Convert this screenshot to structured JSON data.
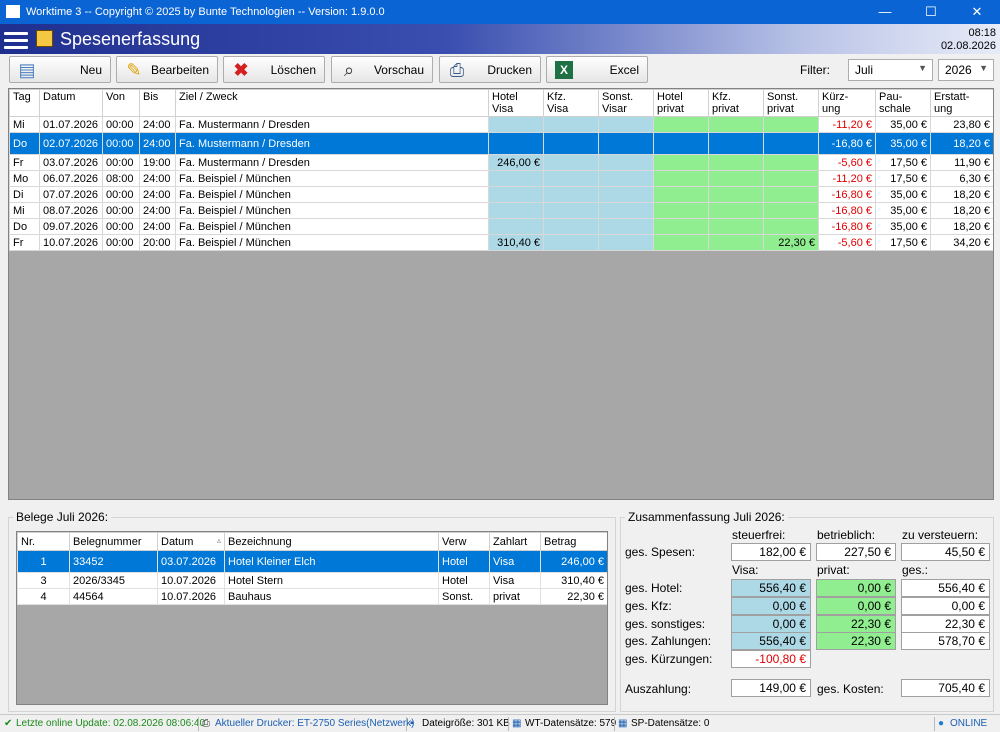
{
  "window": {
    "title": "Worktime 3 -- Copyright © 2025 by Bunte Technologien -- Version: 1.9.0.0",
    "minimize": "—",
    "maximize": "☐",
    "close": "✕"
  },
  "app": {
    "title": "Spesenerfassung",
    "time": "08:18",
    "date": "02.08.2026"
  },
  "toolbar": {
    "new": "Neu",
    "edit": "Bearbeiten",
    "delete": "Löschen",
    "preview": "Vorschau",
    "print": "Drucken",
    "excel": "Excel",
    "filter_label": "Filter:",
    "month": "Juli",
    "year": "2026"
  },
  "grid": {
    "headers": [
      [
        "Tag",
        ""
      ],
      [
        "Datum",
        ""
      ],
      [
        "Von",
        ""
      ],
      [
        "Bis",
        ""
      ],
      [
        "Ziel / Zweck",
        ""
      ],
      [
        "Hotel",
        "Visa"
      ],
      [
        "Kfz.",
        "Visa"
      ],
      [
        "Sonst.",
        "Visar"
      ],
      [
        "Hotel",
        "privat"
      ],
      [
        "Kfz.",
        "privat"
      ],
      [
        "Sonst.",
        "privat"
      ],
      [
        "Kürz-",
        "ung"
      ],
      [
        "Pau-",
        "schale"
      ],
      [
        "Erstatt-",
        "ung"
      ]
    ],
    "rows": [
      {
        "tag": "Mi",
        "datum": "01.07.2026",
        "von": "00:00",
        "bis": "24:00",
        "ziel": "Fa. Mustermann / Dresden",
        "hv": "",
        "kv": "",
        "sv": "",
        "hp": "",
        "kp": "",
        "sp": "",
        "kuerz": "-11,20 €",
        "pausch": "35,00 €",
        "erst": "23,80 €"
      },
      {
        "tag": "Do",
        "datum": "02.07.2026",
        "von": "00:00",
        "bis": "24:00",
        "ziel": "Fa. Mustermann / Dresden",
        "hv": "",
        "kv": "",
        "sv": "",
        "hp": "",
        "kp": "",
        "sp": "",
        "kuerz": "-16,80 €",
        "pausch": "35,00 €",
        "erst": "18,20 €"
      },
      {
        "tag": "Fr",
        "datum": "03.07.2026",
        "von": "00:00",
        "bis": "19:00",
        "ziel": "Fa. Mustermann / Dresden",
        "hv": "246,00 €",
        "kv": "",
        "sv": "",
        "hp": "",
        "kp": "",
        "sp": "",
        "kuerz": "-5,60 €",
        "pausch": "17,50 €",
        "erst": "11,90 €"
      },
      {
        "tag": "Mo",
        "datum": "06.07.2026",
        "von": "08:00",
        "bis": "24:00",
        "ziel": "Fa. Beispiel / München",
        "hv": "",
        "kv": "",
        "sv": "",
        "hp": "",
        "kp": "",
        "sp": "",
        "kuerz": "-11,20 €",
        "pausch": "17,50 €",
        "erst": "6,30 €"
      },
      {
        "tag": "Di",
        "datum": "07.07.2026",
        "von": "00:00",
        "bis": "24:00",
        "ziel": "Fa. Beispiel / München",
        "hv": "",
        "kv": "",
        "sv": "",
        "hp": "",
        "kp": "",
        "sp": "",
        "kuerz": "-16,80 €",
        "pausch": "35,00 €",
        "erst": "18,20 €"
      },
      {
        "tag": "Mi",
        "datum": "08.07.2026",
        "von": "00:00",
        "bis": "24:00",
        "ziel": "Fa. Beispiel / München",
        "hv": "",
        "kv": "",
        "sv": "",
        "hp": "",
        "kp": "",
        "sp": "",
        "kuerz": "-16,80 €",
        "pausch": "35,00 €",
        "erst": "18,20 €"
      },
      {
        "tag": "Do",
        "datum": "09.07.2026",
        "von": "00:00",
        "bis": "24:00",
        "ziel": "Fa. Beispiel / München",
        "hv": "",
        "kv": "",
        "sv": "",
        "hp": "",
        "kp": "",
        "sp": "",
        "kuerz": "-16,80 €",
        "pausch": "35,00 €",
        "erst": "18,20 €"
      },
      {
        "tag": "Fr",
        "datum": "10.07.2026",
        "von": "00:00",
        "bis": "20:00",
        "ziel": "Fa. Beispiel / München",
        "hv": "310,40 €",
        "kv": "",
        "sv": "",
        "hp": "",
        "kp": "",
        "sp": "22,30 €",
        "kuerz": "-5,60 €",
        "pausch": "17,50 €",
        "erst": "34,20 €"
      }
    ]
  },
  "belege": {
    "title": "Belege Juli 2026:",
    "headers": [
      "Nr.",
      "Belegnummer",
      "Datum",
      "Bezeichnung",
      "Verw",
      "Zahlart",
      "Betrag"
    ],
    "sort_indicator": "▵",
    "rows": [
      {
        "nr": "1",
        "nummer": "33452",
        "datum": "03.07.2026",
        "bez": "Hotel Kleiner Elch",
        "verw": "Hotel",
        "zahlart": "Visa",
        "betrag": "246,00 €"
      },
      {
        "nr": "3",
        "nummer": "2026/3345",
        "datum": "10.07.2026",
        "bez": "Hotel Stern",
        "verw": "Hotel",
        "zahlart": "Visa",
        "betrag": "310,40 €"
      },
      {
        "nr": "4",
        "nummer": "44564",
        "datum": "10.07.2026",
        "bez": "Bauhaus",
        "verw": "Sonst.",
        "zahlart": "privat",
        "betrag": "22,30 €"
      }
    ]
  },
  "summary": {
    "title": "Zusammenfassung Juli 2026:",
    "col_steuerfrei": "steuerfrei:",
    "col_betrieblich": "betrieblich:",
    "col_versteuern": "zu versteuern:",
    "lbl_spesen": "ges. Spesen:",
    "spesen_steuerfrei": "182,00 €",
    "spesen_betrieblich": "227,50 €",
    "spesen_versteuern": "45,50 €",
    "col_visa": "Visa:",
    "col_privat": "privat:",
    "col_ges": "ges.:",
    "lbl_hotel": "ges. Hotel:",
    "hotel_visa": "556,40 €",
    "hotel_privat": "0,00 €",
    "hotel_ges": "556,40 €",
    "lbl_kfz": "ges. Kfz:",
    "kfz_visa": "0,00 €",
    "kfz_privat": "0,00 €",
    "kfz_ges": "0,00 €",
    "lbl_sonst": "ges. sonstiges:",
    "sonst_visa": "0,00 €",
    "sonst_privat": "22,30 €",
    "sonst_ges": "22,30 €",
    "lbl_zahl": "ges. Zahlungen:",
    "zahl_visa": "556,40 €",
    "zahl_privat": "22,30 €",
    "zahl_ges": "578,70 €",
    "lbl_kuerz": "ges. Kürzungen:",
    "kuerz": "-100,80 €",
    "lbl_auszahlung": "Auszahlung:",
    "auszahlung": "149,00 €",
    "lbl_kosten": "ges. Kosten:",
    "kosten": "705,40 €"
  },
  "status": {
    "update": "Letzte online Update: 02.08.2026 08:06:40",
    "printer": "Aktueller Drucker: ET-2750 Series(Netzwerk)",
    "filesize": "Dateigröße: 301 KB",
    "wt": "WT-Datensätze: 579",
    "sp": "SP-Datensätze: 0",
    "online": "ONLINE"
  },
  "colors": {
    "visa": "#add8e6",
    "privat": "#90ee90",
    "selection": "#0078d7",
    "negative": "#e00000"
  }
}
